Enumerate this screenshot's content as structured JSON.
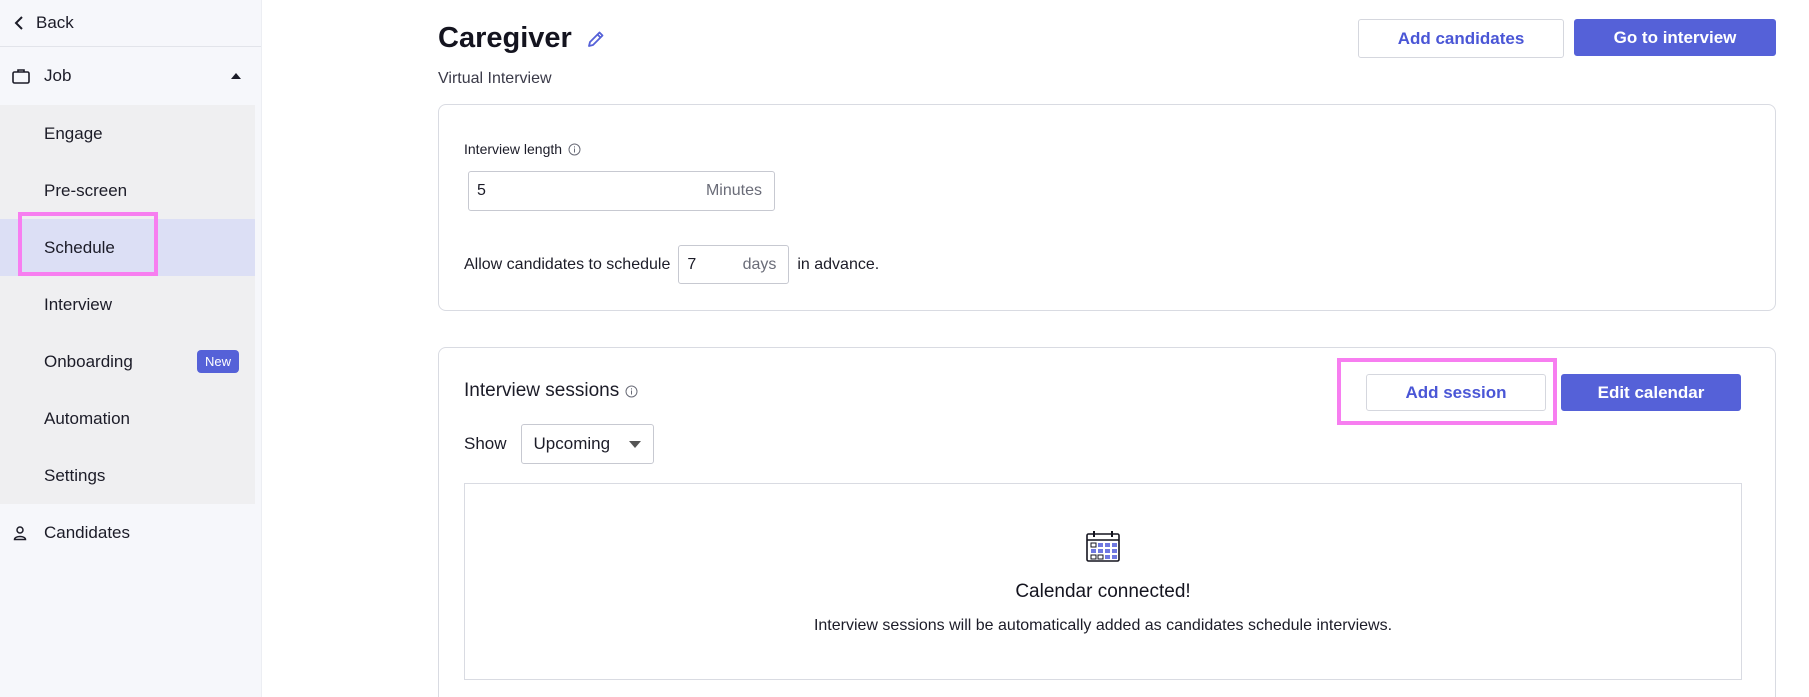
{
  "sidebar": {
    "back_label": "Back",
    "job_label": "Job",
    "items": [
      {
        "label": "Engage"
      },
      {
        "label": "Pre-screen"
      },
      {
        "label": "Schedule"
      },
      {
        "label": "Interview"
      },
      {
        "label": "Onboarding",
        "badge": "New"
      },
      {
        "label": "Automation"
      },
      {
        "label": "Settings"
      }
    ],
    "candidates_label": "Candidates",
    "active_item": "Schedule"
  },
  "header": {
    "title": "Caregiver",
    "subtitle": "Virtual Interview",
    "add_candidates_label": "Add candidates",
    "go_to_interview_label": "Go to interview"
  },
  "interview_settings": {
    "length_label": "Interview length",
    "length_value": "5",
    "length_unit": "Minutes",
    "advance_prefix": "Allow candidates to schedule",
    "advance_value": "7",
    "advance_unit": "days",
    "advance_suffix": "in advance."
  },
  "sessions": {
    "title": "Interview sessions",
    "add_session_label": "Add session",
    "edit_calendar_label": "Edit calendar",
    "show_label": "Show",
    "show_selected": "Upcoming",
    "empty_title": "Calendar connected!",
    "empty_description": "Interview sessions will be automatically added as candidates schedule interviews."
  },
  "colors": {
    "accent": "#5561d8",
    "highlight": "#f77ef0",
    "active_bg": "#dcdff5"
  },
  "icons": [
    "chevron-left-icon",
    "briefcase-icon",
    "caret-up-icon",
    "person-icon",
    "pencil-icon",
    "info-icon",
    "caret-down-icon",
    "calendar-icon"
  ]
}
